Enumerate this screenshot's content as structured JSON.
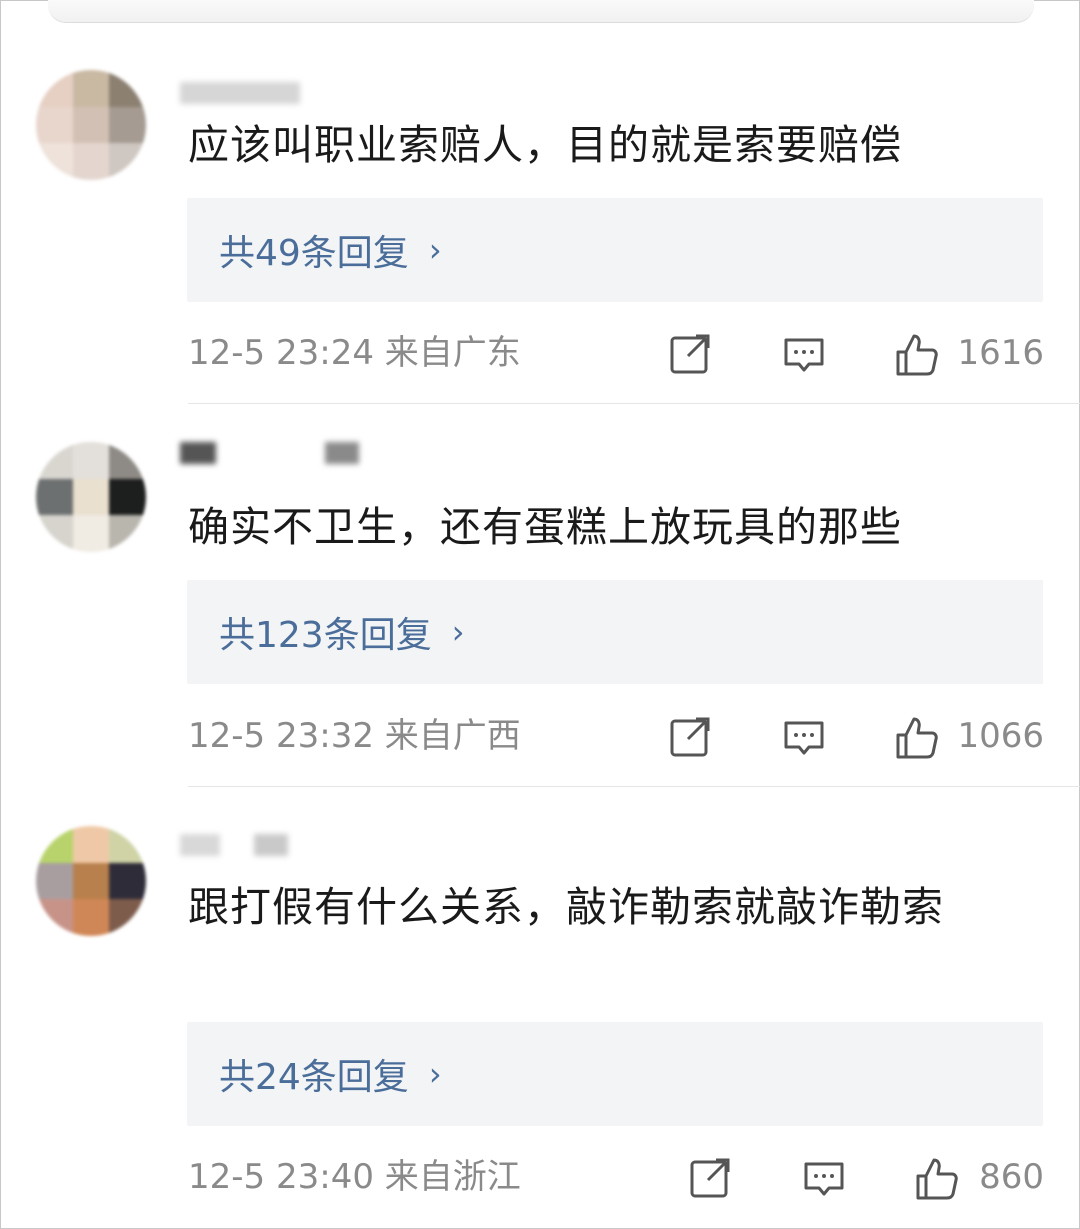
{
  "comments": [
    {
      "username": "",
      "text": "应该叫职业索赔人，目的就是索要赔偿",
      "replies_label": "共49条回复",
      "time_location": "12-5 23:24 来自广东",
      "likes": "1616",
      "avatar_colors": [
        "#e6cfc3",
        "#c9b9a3",
        "#8c8071",
        "#e8d6cc",
        "#d2c0b4",
        "#a59b92",
        "#eee2db",
        "#e4d6cf",
        "#cfc7c1"
      ]
    },
    {
      "username": "",
      "text": "确实不卫生，还有蛋糕上放玩具的那些",
      "replies_label": "共123条回复",
      "time_location": "12-5 23:32 来自广西",
      "likes": "1066",
      "avatar_colors": [
        "#d9d6d0",
        "#e3dfda",
        "#8e8a85",
        "#6d7070",
        "#e9e0cf",
        "#1d1f1e",
        "#d6d4cd",
        "#f0ebe3",
        "#b9b6ae"
      ]
    },
    {
      "username": "",
      "text": "跟打假有什么关系，敲诈勒索就敲诈勒索",
      "replies_label": "共24条回复",
      "time_location": "12-5 23:40 来自浙江",
      "likes": "860",
      "avatar_colors": [
        "#b8d36c",
        "#efc9a7",
        "#cfd3a6",
        "#a89ea0",
        "#b8804c",
        "#2f2c39",
        "#c79389",
        "#d08757",
        "#7d5c4c"
      ]
    }
  ],
  "icons": [
    "share-icon",
    "comment-icon",
    "like-icon"
  ]
}
